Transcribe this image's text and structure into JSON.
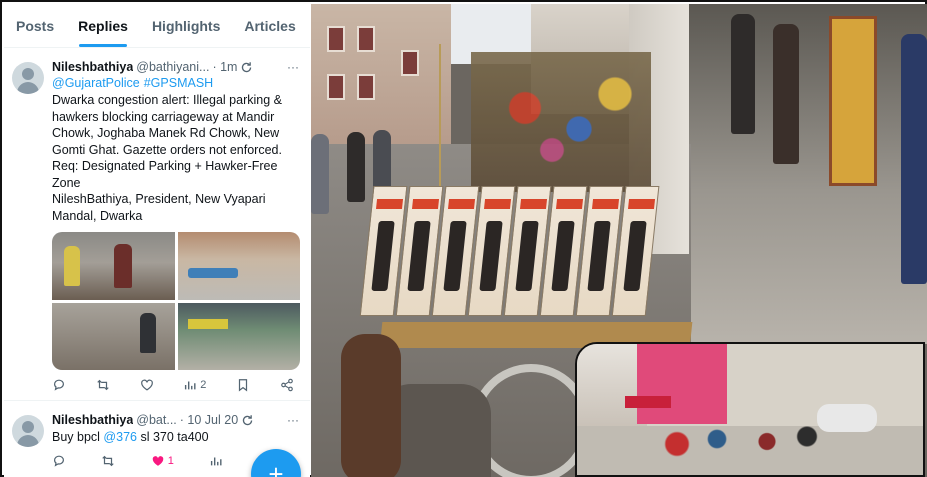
{
  "tabs": [
    {
      "label": "Posts",
      "active": false
    },
    {
      "label": "Replies",
      "active": true
    },
    {
      "label": "Highlights",
      "active": false
    },
    {
      "label": "Articles",
      "active": false
    }
  ],
  "tweet1": {
    "name": "Nileshbathiya",
    "handle": "@bathiyani...",
    "time": "· 1m",
    "mentions": [
      "@GujaratPolice",
      "#GPSMASH"
    ],
    "text": "Dwarka congestion alert: Illegal parking & hawkers blocking carriageway at Mandir Chowk, Joghaba Manek Rd Chowk, New Gomti Ghat. Gazette orders not enforced. Req: Designated Parking + Hawker-Free Zone\n NileshBathiya, President, New Vyapari Mandal, Dwarka",
    "views": "2",
    "icons": [
      "reply-icon",
      "retweet-icon",
      "like-icon",
      "views-icon",
      "bookmark-icon",
      "share-icon"
    ]
  },
  "tweet2": {
    "name": "Nileshbathiya",
    "handle": "@bat...",
    "time": "· 10 Jul 20",
    "text_prefix": "Buy bpcl ",
    "link": "@376",
    "text_suffix": " sl 370 ta400",
    "likes": "1"
  },
  "fab": {
    "label": "+"
  },
  "colors": {
    "accent": "#1d9bf0",
    "like": "#f91880",
    "muted": "#536471"
  }
}
